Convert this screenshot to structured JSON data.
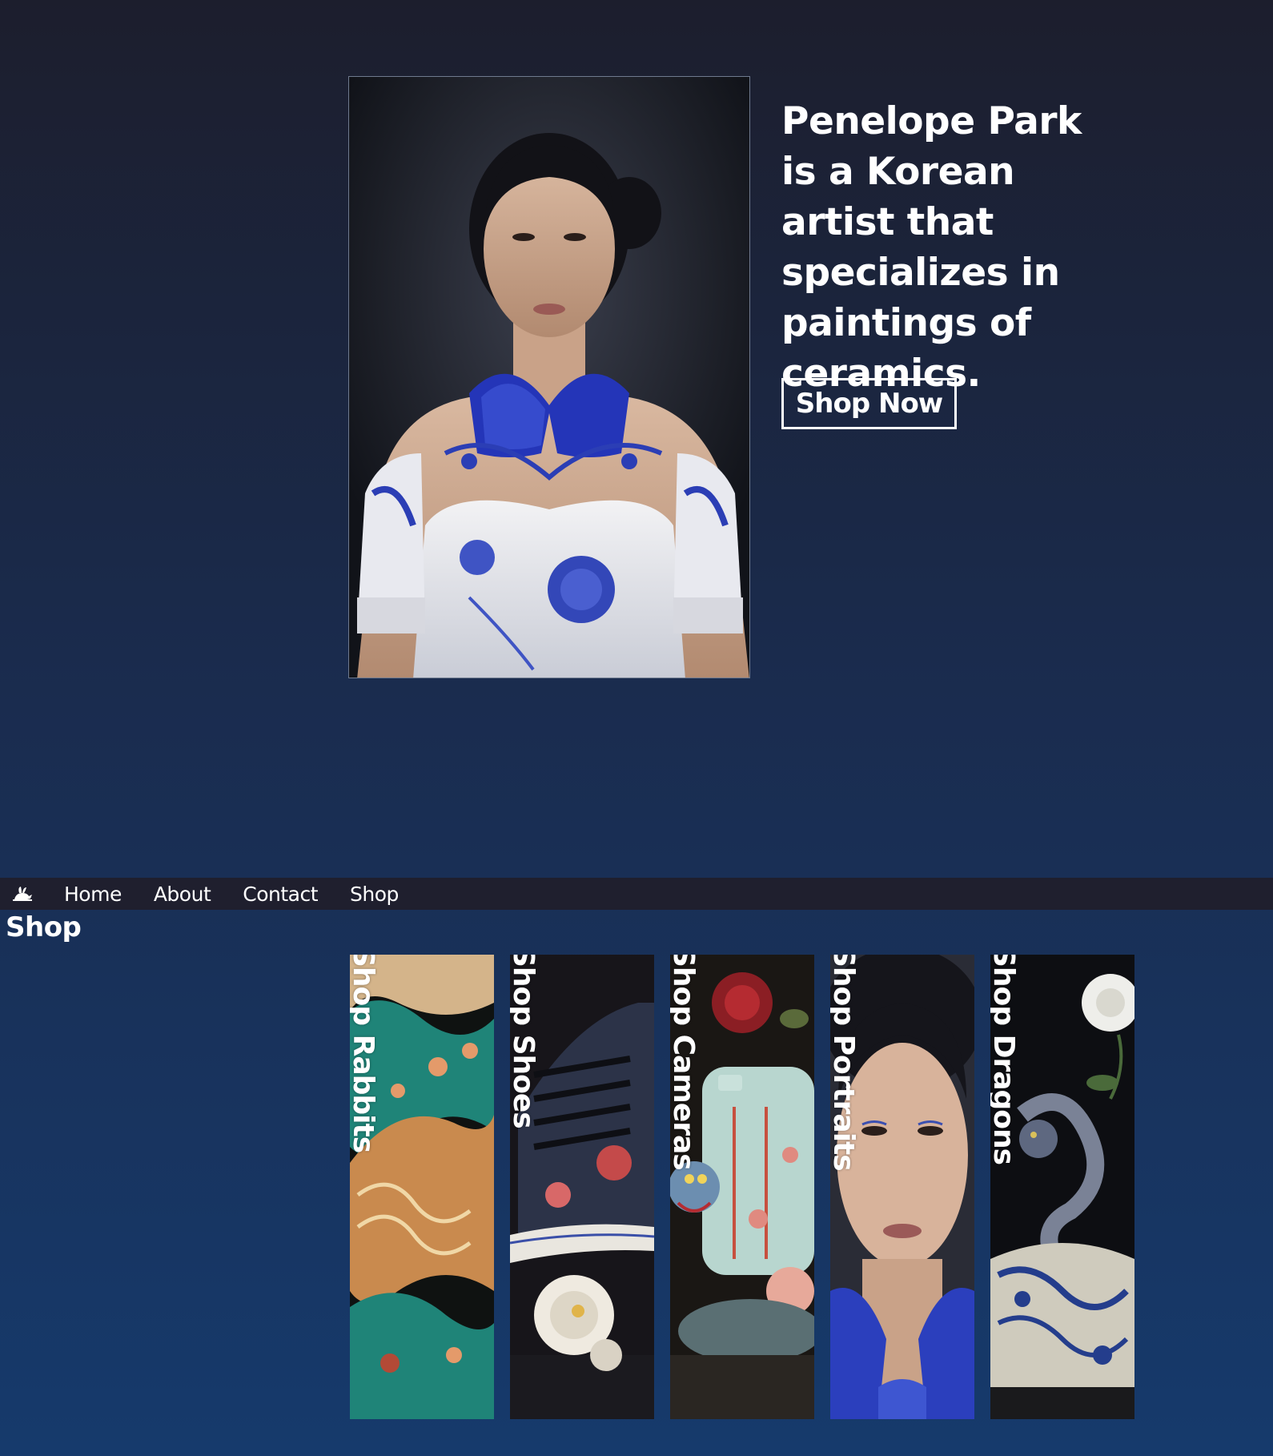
{
  "hero": {
    "headline": "Penelope Park is a Korean artist that specializes in paintings of ceramics.",
    "cta_label": "Shop Now"
  },
  "nav": {
    "logo_icon": "rabbit-icon",
    "items": [
      {
        "label": "Home"
      },
      {
        "label": "About"
      },
      {
        "label": "Contact"
      },
      {
        "label": "Shop"
      }
    ]
  },
  "shop": {
    "heading": "Shop",
    "cards": [
      {
        "label": "Shop Rabbits"
      },
      {
        "label": "Shop Shoes"
      },
      {
        "label": "Shop Cameras"
      },
      {
        "label": "Shop Portraits"
      },
      {
        "label": "Shop Dragons"
      }
    ]
  },
  "colors": {
    "background_top": "#1c1e2d",
    "background_bottom": "#163a6c",
    "navbar": "#1f1f2e",
    "porcelain_blue": "#2a3fb0"
  }
}
